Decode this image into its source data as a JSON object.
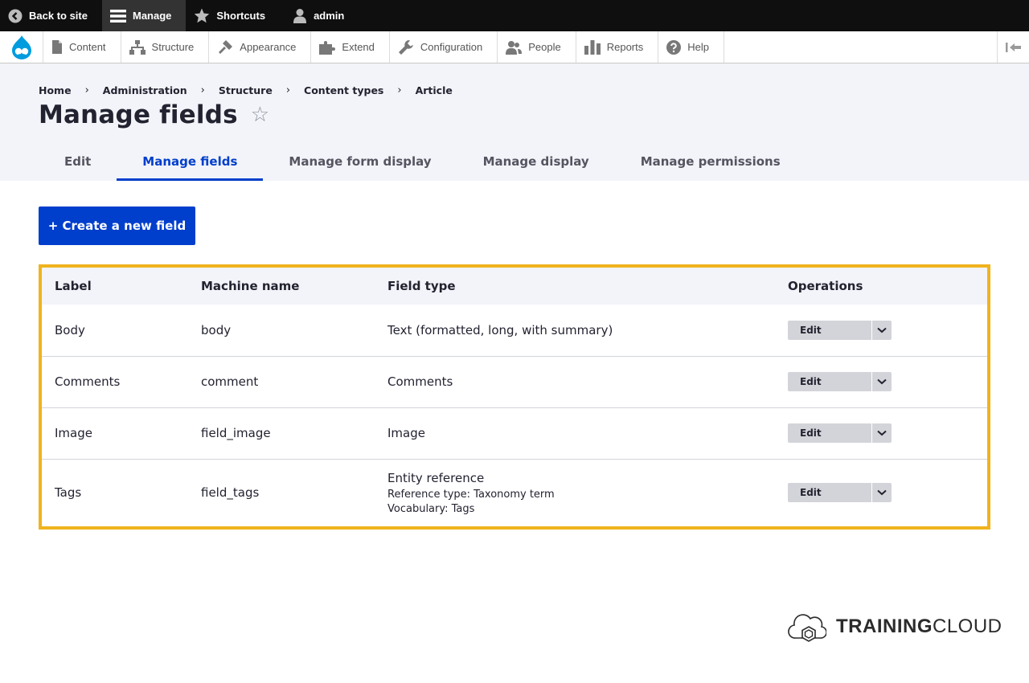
{
  "toolbar": {
    "back_label": "Back to site",
    "manage_label": "Manage",
    "shortcuts_label": "Shortcuts",
    "user_label": "admin"
  },
  "tray": {
    "items": [
      {
        "label": "Content",
        "icon": "content-icon"
      },
      {
        "label": "Structure",
        "icon": "structure-icon"
      },
      {
        "label": "Appearance",
        "icon": "appearance-icon"
      },
      {
        "label": "Extend",
        "icon": "extend-icon"
      },
      {
        "label": "Configuration",
        "icon": "configuration-icon"
      },
      {
        "label": "People",
        "icon": "people-icon"
      },
      {
        "label": "Reports",
        "icon": "reports-icon"
      },
      {
        "label": "Help",
        "icon": "help-icon"
      }
    ]
  },
  "breadcrumb": [
    "Home",
    "Administration",
    "Structure",
    "Content types",
    "Article"
  ],
  "page": {
    "title": "Manage fields",
    "star": "☆"
  },
  "tabs": [
    {
      "label": "Edit",
      "active": false
    },
    {
      "label": "Manage fields",
      "active": true
    },
    {
      "label": "Manage form display",
      "active": false
    },
    {
      "label": "Manage display",
      "active": false
    },
    {
      "label": "Manage permissions",
      "active": false
    }
  ],
  "create_button": "+ Create a new field",
  "table": {
    "headers": [
      "Label",
      "Machine name",
      "Field type",
      "Operations"
    ],
    "rows": [
      {
        "label": "Body",
        "machine": "body",
        "type": "Text (formatted, long, with summary)",
        "op": "Edit"
      },
      {
        "label": "Comments",
        "machine": "comment",
        "type": "Comments",
        "op": "Edit"
      },
      {
        "label": "Image",
        "machine": "field_image",
        "type": "Image",
        "op": "Edit"
      },
      {
        "label": "Tags",
        "machine": "field_tags",
        "type": "Entity reference",
        "sub1": "Reference type: Taxonomy term",
        "sub2": "Vocabulary: Tags",
        "op": "Edit"
      }
    ]
  },
  "brand": {
    "bold": "TRAINING",
    "light": "CLOUD"
  },
  "colors": {
    "primary": "#003ecc",
    "highlight": "#f0b31e",
    "toolbar": "#0f0f0f"
  }
}
